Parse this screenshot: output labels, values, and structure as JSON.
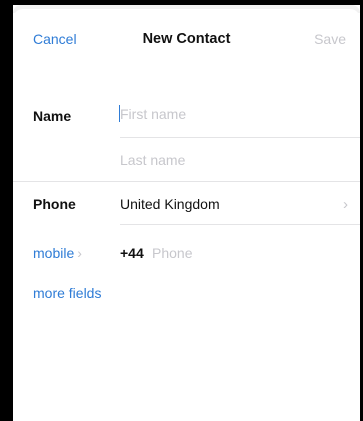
{
  "header": {
    "cancel_label": "Cancel",
    "title": "New Contact",
    "save_label": "Save"
  },
  "name_section": {
    "label": "Name",
    "first_name_placeholder": "First name",
    "last_name_placeholder": "Last name"
  },
  "phone_section": {
    "label": "Phone",
    "country": "United Kingdom",
    "type_label": "mobile",
    "dial_code": "+44",
    "number_placeholder": "Phone"
  },
  "more_fields_label": "more fields",
  "colors": {
    "accent": "#2f7cd6",
    "placeholder": "#c7c7cc",
    "text": "#111111"
  }
}
